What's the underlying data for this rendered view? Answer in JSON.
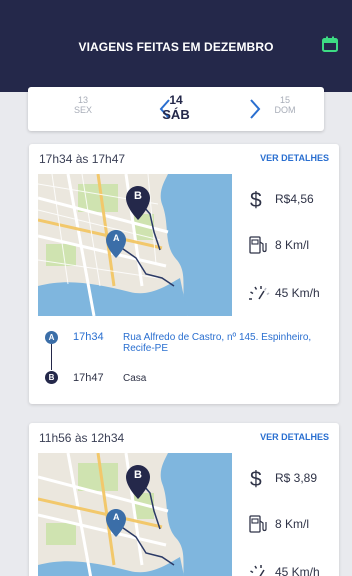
{
  "header": {
    "title": "VIAGENS FEITAS EM DEZEMBRO",
    "calendar_icon": "calendar-icon",
    "accent": "#3ddc84"
  },
  "date_nav": {
    "prev": {
      "num": "13",
      "day": "SEX"
    },
    "current": {
      "num": "14",
      "day": "SÁB"
    },
    "next": {
      "num": "15",
      "day": "DOM"
    }
  },
  "trips": [
    {
      "time_range": "17h34 às 17h47",
      "details_label": "VER DETALHES",
      "cost": "R$4,56",
      "consumption": "8 Km/l",
      "speed": "45 Km/h",
      "start": {
        "marker": "A",
        "time": "17h34",
        "address": "Rua Alfredo de Castro, nº 145. Espinheiro, Recife-PE"
      },
      "end": {
        "marker": "B",
        "time": "17h47",
        "address": "Casa"
      }
    },
    {
      "time_range": "11h56 às 12h34",
      "details_label": "VER DETALHES",
      "cost": "R$ 3,89",
      "consumption": "8 Km/l",
      "speed": "45 Km/h",
      "start": {
        "marker": "A"
      },
      "end": {
        "marker": "B"
      }
    }
  ],
  "colors": {
    "header_bg": "#24284a",
    "link": "#2a6fd0",
    "marker_a": "#3b6ea8",
    "marker_b": "#24284a"
  }
}
